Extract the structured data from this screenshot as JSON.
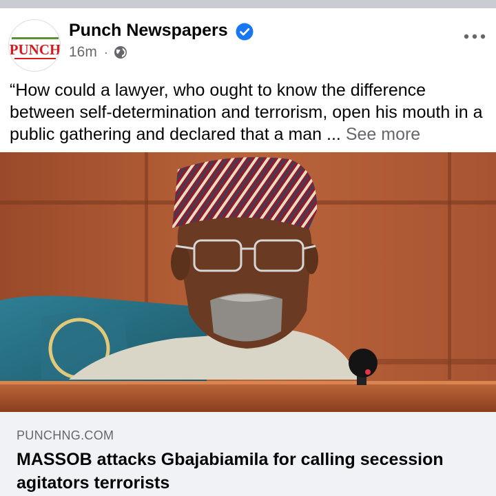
{
  "post": {
    "author": "Punch Newspapers",
    "avatar_logo_text": "PUNCH",
    "time": "16m",
    "separator": "·",
    "privacy_icon": "globe-icon",
    "verified_icon": "verified-badge-icon",
    "more_icon": "more-options-icon",
    "text": "“How could a lawyer, who ought to know the difference between self-determination and terrorism, open his mouth in a public gathering and declared that a man ...",
    "see_more": "See more"
  },
  "link_preview": {
    "domain": "PUNCHNG.COM",
    "title": "MASSOB attacks Gbajabiamila for calling secession agitators terrorists"
  },
  "colors": {
    "divider": "#c9ccd1",
    "secondary_text": "#65676b",
    "verified_blue": "#1877f2",
    "preview_background": "#f0f2f5",
    "punch_red": "#d71920"
  }
}
